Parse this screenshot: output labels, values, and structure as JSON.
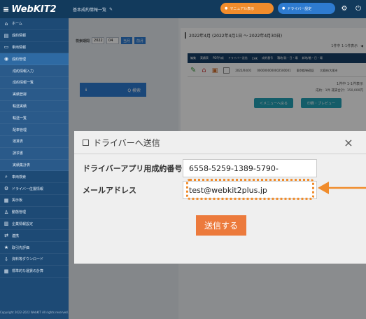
{
  "app": {
    "logo": "WebKIT2"
  },
  "header": {
    "breadcrumb": "基本成約情報一覧",
    "orange_pill": "マニュアル表示",
    "blue_pill": "ドライバー設定"
  },
  "sidebar": {
    "items": [
      {
        "label": "ホーム",
        "icon": "home-icon",
        "sub": false
      },
      {
        "label": "成約情報",
        "icon": "doc-icon",
        "sub": false
      },
      {
        "label": "車両情報",
        "icon": "truck-icon",
        "sub": false
      },
      {
        "label": "成約管理",
        "icon": "eye-icon",
        "sub": false,
        "active": true
      },
      {
        "label": "成約情報入力",
        "icon": "",
        "sub": true
      },
      {
        "label": "成約情報一覧",
        "icon": "",
        "sub": true
      },
      {
        "label": "実績登録",
        "icon": "",
        "sub": true
      },
      {
        "label": "輸送実績",
        "icon": "",
        "sub": true
      },
      {
        "label": "輸送一覧",
        "icon": "",
        "sub": true
      },
      {
        "label": "配車管理",
        "icon": "",
        "sub": true
      },
      {
        "label": "運賃表",
        "icon": "",
        "sub": true
      },
      {
        "label": "請求書",
        "icon": "",
        "sub": true
      },
      {
        "label": "実績集計表",
        "icon": "",
        "sub": true
      },
      {
        "label": "車両検索",
        "icon": "search-icon",
        "sub": false
      },
      {
        "label": "ドライバー位置情報",
        "icon": "gear-icon",
        "sub": false
      },
      {
        "label": "掲示板",
        "icon": "board-icon",
        "sub": false
      },
      {
        "label": "動態管理",
        "icon": "person-icon",
        "sub": false
      },
      {
        "label": "企業情報設定",
        "icon": "building-icon",
        "sub": false
      },
      {
        "label": "連携",
        "icon": "link-icon",
        "sub": false
      },
      {
        "label": "取引先評価",
        "icon": "star-icon",
        "sub": false
      },
      {
        "label": "資料等ダウンロード",
        "icon": "download-icon",
        "sub": false
      },
      {
        "label": "標準的な運賃の計算",
        "icon": "calc-icon",
        "sub": false
      }
    ],
    "copyright": "Copyright 2022-2022 WebKIT All rights reserved."
  },
  "search": {
    "label": "検索期間",
    "from": "2022",
    "to": "04",
    "btn_current": "当月",
    "btn_prev": "前月",
    "search_button": "Q 検索"
  },
  "main": {
    "period": "2022年4月 (2022年4月1日 ～ 2022年4月30日)",
    "pager": "1件中 1-1件表示",
    "columns": [
      "編集",
      "実績表",
      "PDF作成",
      "ドライバー送信",
      "CHK",
      "成約番号",
      "積地/発・日・場",
      "卸地/着・日・場"
    ],
    "row": {
      "date": "2022/04/01",
      "number": "0000000000002500001",
      "from": "東京都/新宿区",
      "to": "大阪府/大阪市"
    },
    "pager2": "1件中 1-1件表示",
    "count": "成約：1件 運賃合計：150,000円",
    "btn_menu": "＜メニューへ戻る",
    "btn_preview": "印刷・プレビュー"
  },
  "modal": {
    "title": "ドライバーへ送信",
    "contract_label": "ドライバーアプリ用成約番号",
    "contract_value": "6558-5259-1389-5790-",
    "email_label": "メールアドレス",
    "email_value": "test@webkit2plus.jp",
    "send_button": "送信する",
    "close": "×"
  },
  "colors": {
    "accent": "#f08c2c",
    "sidebar": "#1d4a75",
    "send": "#ec7a3c"
  }
}
